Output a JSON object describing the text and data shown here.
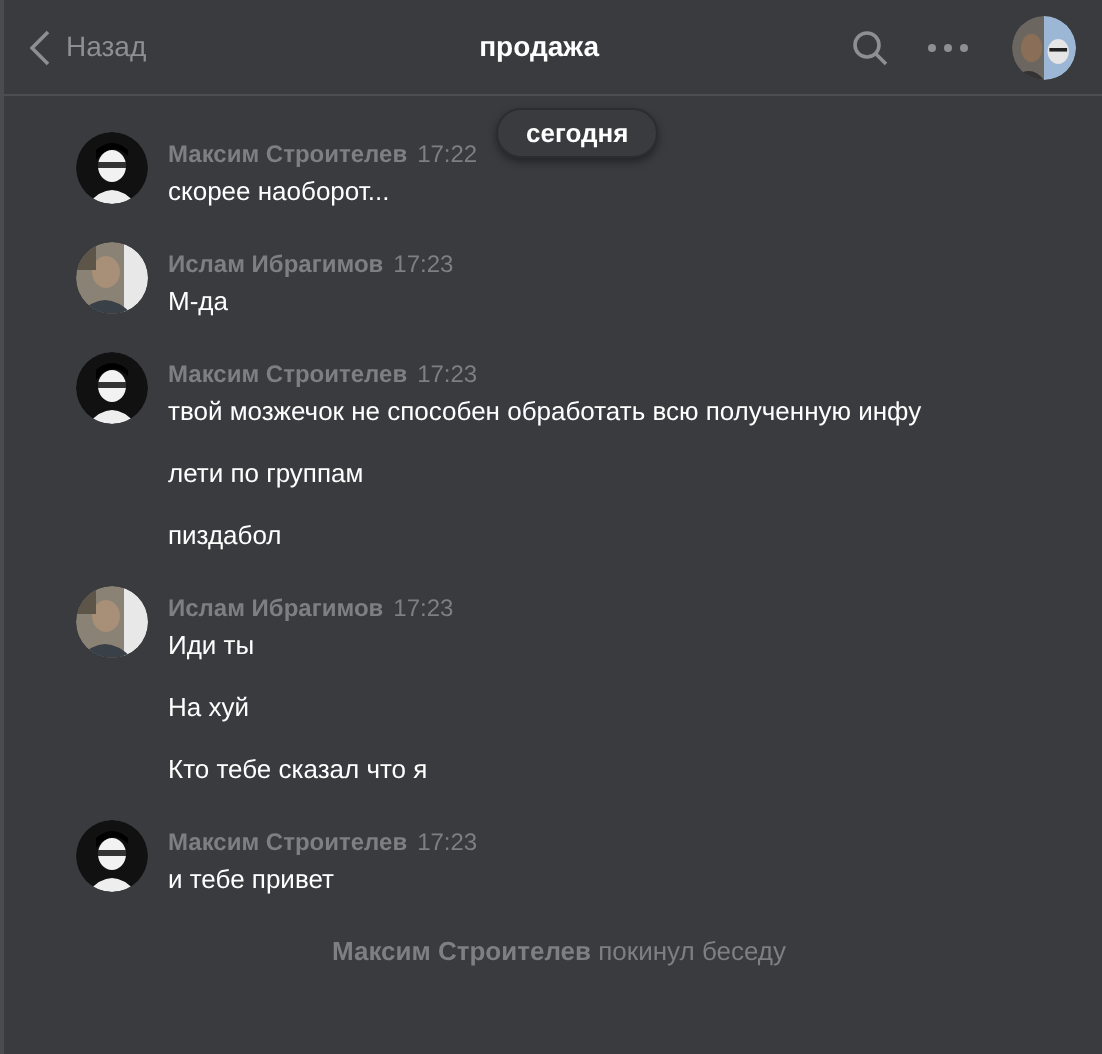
{
  "header": {
    "back": "Назад",
    "title": "продажа"
  },
  "date_pill": "сегодня",
  "groups": [
    {
      "author": "Максим Строителев",
      "time": "17:22",
      "avatar": {
        "kind": "sketch"
      },
      "messages": [
        "скорее наоборот..."
      ]
    },
    {
      "author": "Ислам Ибрагимов",
      "time": "17:23",
      "messages": [
        "М-да"
      ]
    },
    {
      "author": "Максим Строителев",
      "time": "17:23",
      "avatar": {
        "kind": "sketch"
      },
      "messages": [
        "твой мозжечок не способен обработать всю полученную инфу",
        "лети по группам",
        "пиздабол"
      ]
    },
    {
      "author": "Ислам Ибрагимов",
      "time": "17:23",
      "messages": [
        "Иди ты",
        "На хуй",
        "Кто тебе сказал что я"
      ]
    },
    {
      "author": "Максим Строителев",
      "time": "17:23",
      "avatar": {
        "kind": "sketch"
      },
      "messages": [
        "и тебе привет"
      ]
    }
  ],
  "system_message": "**Максим Строителев** покинул беседу"
}
